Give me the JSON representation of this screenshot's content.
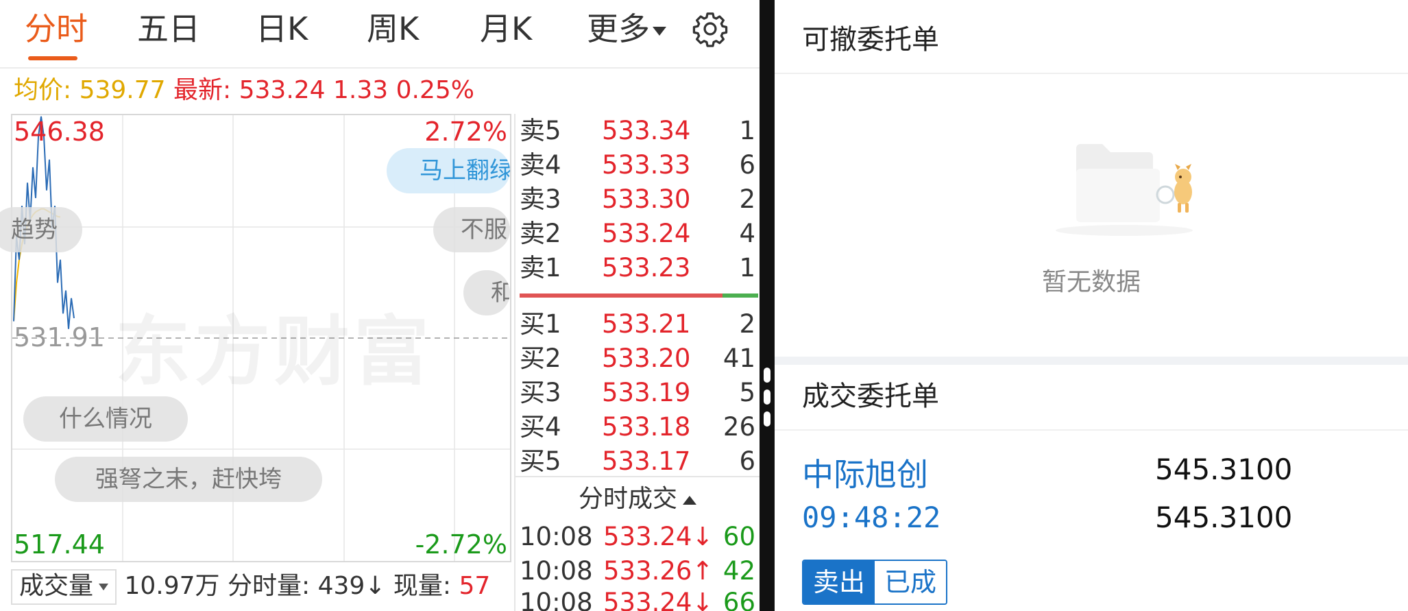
{
  "tabs": [
    {
      "label": "分时",
      "active": true
    },
    {
      "label": "五日"
    },
    {
      "label": "日K"
    },
    {
      "label": "周K"
    },
    {
      "label": "月K"
    },
    {
      "label": "更多"
    }
  ],
  "settings_icon": "gear-icon",
  "pricebar": {
    "avg_label": "均价:",
    "avg_value": "539.77",
    "latest_label": "最新:",
    "latest_value": "533.24",
    "change": "1.33",
    "change_pct": "0.25%"
  },
  "chart": {
    "y_high": "546.38",
    "y_mid": "531.91",
    "y_low": "517.44",
    "pct_high": "2.72%",
    "pct_low": "-2.72%",
    "watermark": "东方财富",
    "pills": [
      "马上翻绿",
      "趋势",
      "不服",
      "和",
      "什么情况",
      "强弩之末，赶快垮"
    ],
    "colors": {
      "price_line": "#2a6bb5",
      "avg_line": "#f0b400",
      "up": "#e3242b",
      "down": "#1a9a1a"
    }
  },
  "chart_data": {
    "type": "line",
    "ylim": [
      517.44,
      546.38
    ],
    "baseline": 531.91,
    "series": [
      {
        "values": [
          533.0,
          538.5,
          537.0,
          540.5,
          538.0,
          542.0,
          539.5,
          543.0,
          541.0,
          545.0,
          546.3,
          545.0,
          541.5,
          543.5,
          539.0,
          540.5,
          535.5,
          537.0,
          533.5,
          535.0,
          532.5,
          534.5,
          533.2
        ]
      },
      {
        "values": [
          533.0,
          535.5,
          537.0,
          538.0,
          538.8,
          539.2,
          539.6,
          539.9,
          540.1,
          540.2,
          540.3,
          540.3,
          540.2,
          540.1,
          540.0,
          539.9,
          539.8,
          539.77
        ]
      }
    ]
  },
  "volume": {
    "select_label": "成交量",
    "total": "10.97万",
    "minute_label": "分时量:",
    "minute_value": "439",
    "minute_arrow": "↓",
    "current_label": "现量:",
    "current_value": "57"
  },
  "orderbook": {
    "asks": [
      {
        "label": "卖5",
        "price": "533.34",
        "qty": "1"
      },
      {
        "label": "卖4",
        "price": "533.33",
        "qty": "6"
      },
      {
        "label": "卖3",
        "price": "533.30",
        "qty": "2"
      },
      {
        "label": "卖2",
        "price": "533.24",
        "qty": "4"
      },
      {
        "label": "卖1",
        "price": "533.23",
        "qty": "1"
      }
    ],
    "bids": [
      {
        "label": "买1",
        "price": "533.21",
        "qty": "2"
      },
      {
        "label": "买2",
        "price": "533.20",
        "qty": "41"
      },
      {
        "label": "买3",
        "price": "533.19",
        "qty": "5"
      },
      {
        "label": "买4",
        "price": "533.18",
        "qty": "26"
      },
      {
        "label": "买5",
        "price": "533.17",
        "qty": "6"
      }
    ],
    "trades_title": "分时成交",
    "trades": [
      {
        "time": "10:08",
        "price": "533.24↓",
        "vol": "60"
      },
      {
        "time": "10:08",
        "price": "533.26↑",
        "vol": "42"
      },
      {
        "time": "10:08",
        "price": "533.24↓",
        "vol": "66"
      }
    ]
  },
  "right": {
    "cancelable_title": "可撤委托单",
    "empty_text": "暂无数据",
    "filled_title": "成交委托单",
    "order": {
      "name": "中际旭创",
      "time": "09:48:22",
      "price1": "545.3100",
      "price2": "545.3100",
      "side": "卖出",
      "status": "已成"
    }
  }
}
